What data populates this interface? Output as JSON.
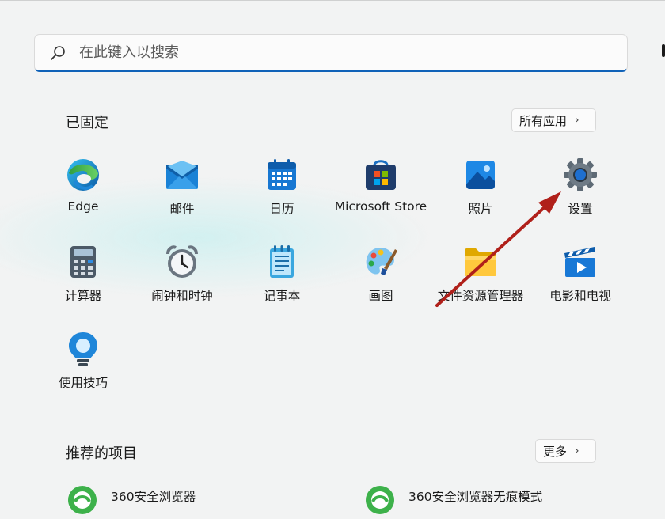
{
  "search": {
    "placeholder": "在此键入以搜索"
  },
  "pinned": {
    "title": "已固定",
    "all_apps_label": "所有应用",
    "apps": [
      {
        "label": "Edge",
        "icon": "edge-icon"
      },
      {
        "label": "邮件",
        "icon": "mail-icon"
      },
      {
        "label": "日历",
        "icon": "calendar-icon"
      },
      {
        "label": "Microsoft Store",
        "icon": "store-icon"
      },
      {
        "label": "照片",
        "icon": "photos-icon"
      },
      {
        "label": "设置",
        "icon": "settings-gear-icon"
      },
      {
        "label": "计算器",
        "icon": "calculator-icon"
      },
      {
        "label": "闹钟和时钟",
        "icon": "alarm-clock-icon"
      },
      {
        "label": "记事本",
        "icon": "notepad-icon"
      },
      {
        "label": "画图",
        "icon": "paint-palette-icon"
      },
      {
        "label": "文件资源管理器",
        "icon": "folder-icon"
      },
      {
        "label": "电影和电视",
        "icon": "movies-tv-icon"
      },
      {
        "label": "使用技巧",
        "icon": "tips-lightbulb-icon"
      }
    ]
  },
  "recommended": {
    "title": "推荐的项目",
    "more_label": "更多",
    "items": [
      {
        "label": "360安全浏览器",
        "icon": "360-browser-icon"
      },
      {
        "label": "360安全浏览器无痕模式",
        "icon": "360-browser-icon"
      }
    ]
  },
  "colors": {
    "accent": "#1062b8",
    "annotation_arrow": "#b0201a"
  }
}
